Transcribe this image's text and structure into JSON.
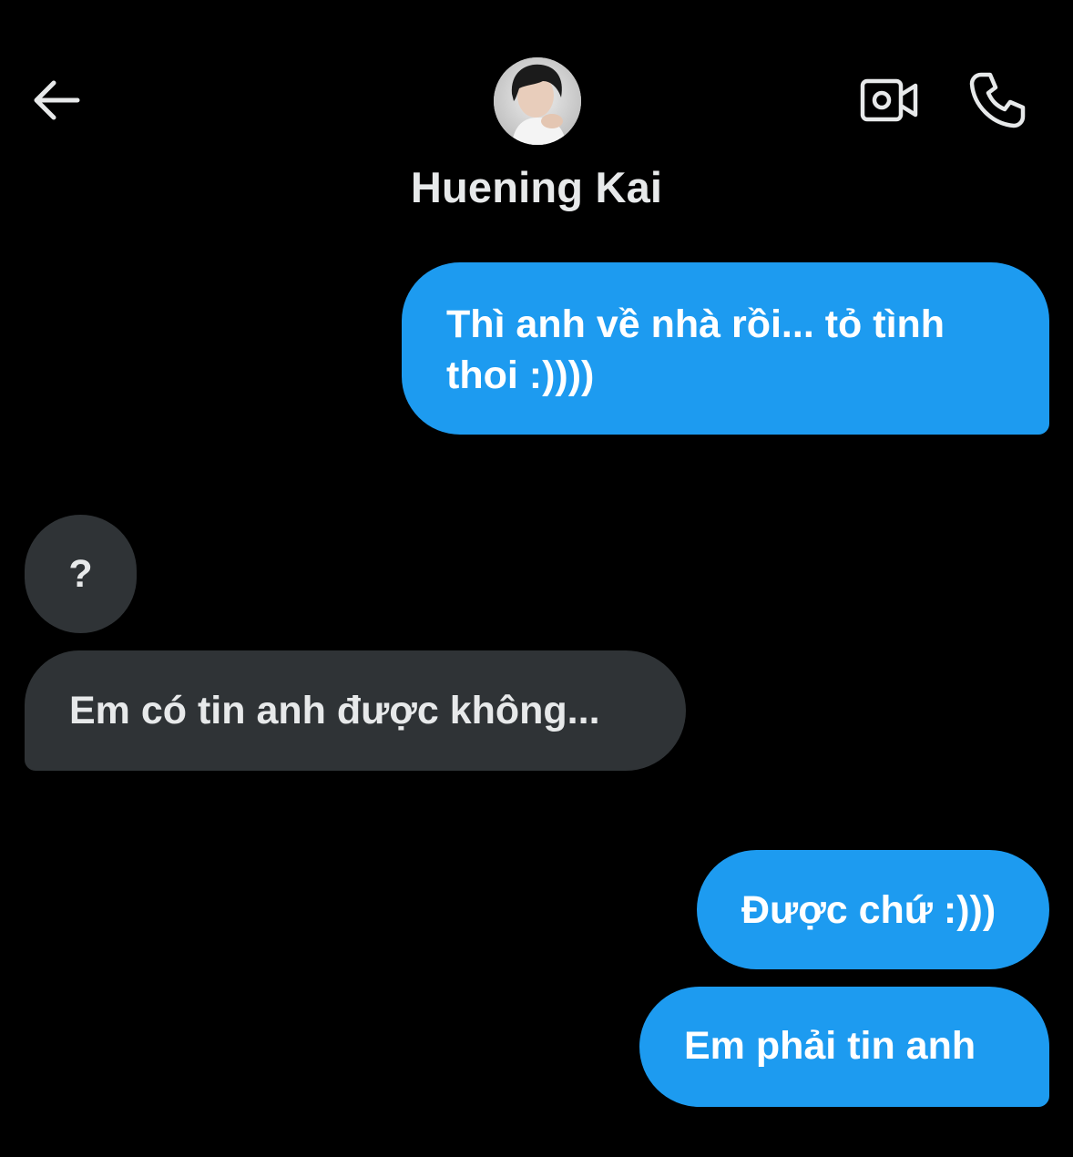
{
  "header": {
    "contact_name": "Huening Kai",
    "back_icon": "arrow-left-icon",
    "video_icon": "video-camera-icon",
    "call_icon": "phone-icon"
  },
  "messages": [
    {
      "direction": "sent",
      "text": "Thì anh về nhà rồi... tỏ tình thoi :))))"
    },
    {
      "direction": "received",
      "text": "?"
    },
    {
      "direction": "received",
      "text": "Em có tin anh được không..."
    },
    {
      "direction": "sent",
      "text": "Được chứ :)))"
    },
    {
      "direction": "sent",
      "text": "Em phải tin anh"
    }
  ],
  "colors": {
    "background": "#000000",
    "sent_bubble": "#1d9bf0",
    "received_bubble": "#2f3336",
    "text": "#e7e9ea"
  }
}
